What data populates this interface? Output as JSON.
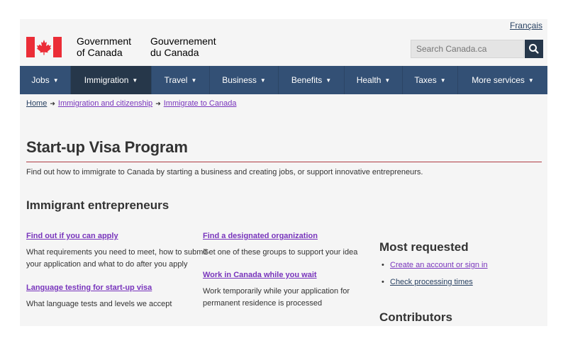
{
  "header": {
    "language_link": "Français",
    "signature_en_line1": "Government",
    "signature_en_line2": "of Canada",
    "signature_fr_line1": "Gouvernement",
    "signature_fr_line2": "du Canada",
    "search_placeholder": "Search Canada.ca",
    "flag_color": "#eb2d37"
  },
  "nav": {
    "items": [
      {
        "label": "Jobs"
      },
      {
        "label": "Immigration"
      },
      {
        "label": "Travel"
      },
      {
        "label": "Business"
      },
      {
        "label": "Benefits"
      },
      {
        "label": "Health"
      },
      {
        "label": "Taxes"
      },
      {
        "label": "More services"
      }
    ],
    "active_index": 1
  },
  "breadcrumb": [
    "Home",
    "Immigration and citizenship",
    "Immigrate to Canada"
  ],
  "main": {
    "title": "Start-up Visa Program",
    "intro": "Find out how to immigrate to Canada by starting a business and creating jobs, or support innovative entrepreneurs.",
    "section_heading": "Immigrant entrepreneurs",
    "services": [
      {
        "link": "Find out if you can apply",
        "desc_line1": "What requirements you need to meet, how to submit",
        "desc_line2": "your application and what to do after you apply"
      },
      {
        "link": "Language testing for start-up visa",
        "desc_line1": "What language tests and levels we accept",
        "desc_line2": ""
      },
      {
        "link": "Find a designated organization",
        "desc_line1": "Get one of these groups to support your idea",
        "desc_line2": ""
      },
      {
        "link": "Work in Canada while you wait",
        "desc_line1": "Work temporarily while your application for",
        "desc_line2": "permanent residence is processed"
      }
    ]
  },
  "sidebar": {
    "most_requested_heading": "Most requested",
    "links": [
      "Create an account or sign in",
      "Check processing times"
    ],
    "contributors_heading": "Contributors"
  },
  "colors": {
    "nav_bg": "#335075",
    "nav_active": "#26374a",
    "link": "#284162",
    "visited_link": "#7834bc",
    "title_rule": "#af3c43"
  }
}
